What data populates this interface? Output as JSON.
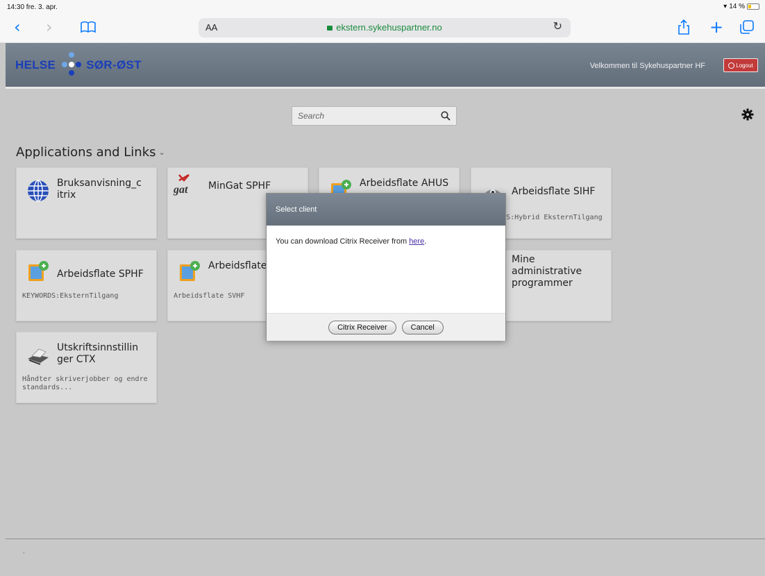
{
  "statusbar": {
    "time": "14:30  fre. 3. apr.",
    "battery": "14 %"
  },
  "browser": {
    "text_size_label": "AA",
    "url": "ekstern.sykehuspartner.no"
  },
  "header": {
    "logo_left": "HELSE",
    "logo_right": "SØR-ØST",
    "welcome": "Velkommen til Sykehuspartner HF",
    "logout": "Logout"
  },
  "search": {
    "placeholder": "Search"
  },
  "section": {
    "title": "Applications and Links"
  },
  "tiles": [
    {
      "name": "Bruksanvisning_c itrix",
      "keywords": "",
      "icon": "globe-icon"
    },
    {
      "name": "MinGat SPHF",
      "keywords": "",
      "icon": "gat-logo-icon"
    },
    {
      "name": "Arbeidsflate AHUS",
      "keywords": "",
      "icon": "citrix-app-icon"
    },
    {
      "name": "Arbeidsflate SIHF",
      "keywords": "KEYWORDS:Hybrid EksternTilgang",
      "icon": "eye-icon"
    },
    {
      "name": "Arbeidsflate SPHF",
      "keywords": "KEYWORDS:EksternTilgang",
      "icon": "citrix-app-icon"
    },
    {
      "name": "Arbeidsflate SVHF",
      "keywords": "Arbeidsflate SVHF",
      "icon": "citrix-app-icon"
    },
    {
      "name": "Mine administrative programmer",
      "keywords": "",
      "icon": "folder-icon"
    },
    {
      "name": "Utskriftsinnstillin ger CTX",
      "keywords": "Håndter skriverjobber og endre standards...",
      "icon": "printer-icon"
    }
  ],
  "modal": {
    "title": "Select client",
    "body_prefix": "You can download Citrix Receiver from ",
    "link": "here",
    "body_suffix": ".",
    "primary_button": "Citrix Receiver",
    "cancel_button": "Cancel"
  },
  "footer": {
    "dot": "."
  },
  "colors": {
    "header": "#6b7683",
    "background": "#c8c8c8",
    "logo_blue": "#1a3fb8",
    "url_green": "#1a8c3c",
    "safari_blue": "#0a7aff"
  }
}
